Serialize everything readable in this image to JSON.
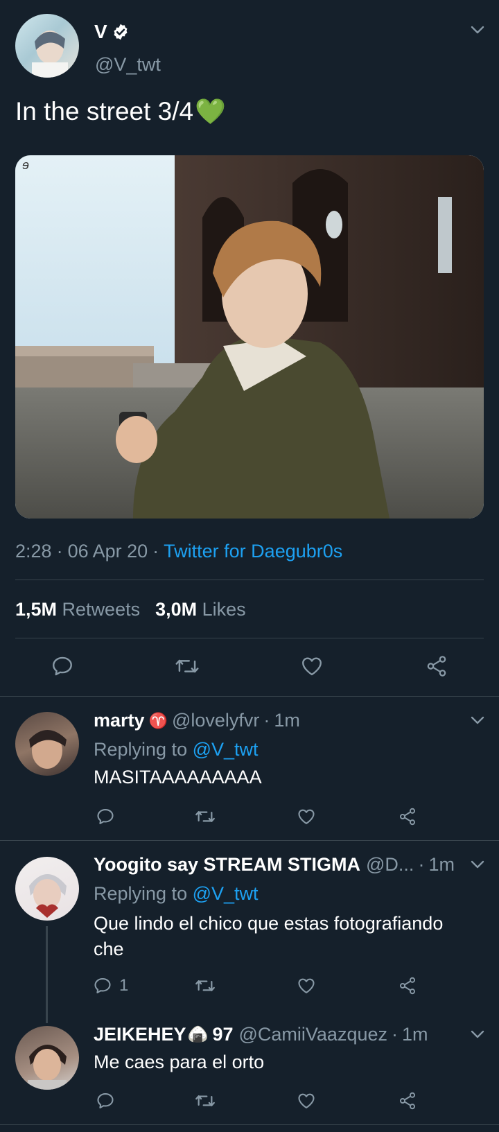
{
  "tweet": {
    "display_name": "V",
    "handle": "@V_twt",
    "text": "In the street 3/4",
    "emoji": "💚",
    "time": "2:28",
    "date": "06 Apr 20",
    "sep": "·",
    "source": "Twitter for Daegubr0s",
    "photo_signature": "ɘ",
    "retweets_count": "1,5M",
    "retweets_label": "Retweets",
    "likes_count": "3,0M",
    "likes_label": "Likes"
  },
  "replies": [
    {
      "name": "marty",
      "name_symbol": "♈",
      "handle": "@lovelyfvr",
      "time": "1m",
      "replying_label": "Replying to",
      "replying_handle": "@V_twt",
      "text": "MASITAAAAAAAAA",
      "reply_count": ""
    },
    {
      "name": "Yoogito say STREAM STIGMA",
      "handle": "@D...",
      "time": "1m",
      "replying_label": "Replying to",
      "replying_handle": "@V_twt",
      "text_line1": "Que lindo el chico que estas fotografiando",
      "text_line2": "che",
      "reply_count": "1"
    },
    {
      "name": "JEIKEHEY",
      "name_emoji": "🍙",
      "name_suffix": "97",
      "handle": "@CamiiVaazquez",
      "time": "1m",
      "text": "Me caes para el orto",
      "reply_count": ""
    }
  ],
  "colors": {
    "background": "#15202b",
    "muted": "#8899a6",
    "link": "#1da1f2",
    "divider": "#38444d"
  }
}
